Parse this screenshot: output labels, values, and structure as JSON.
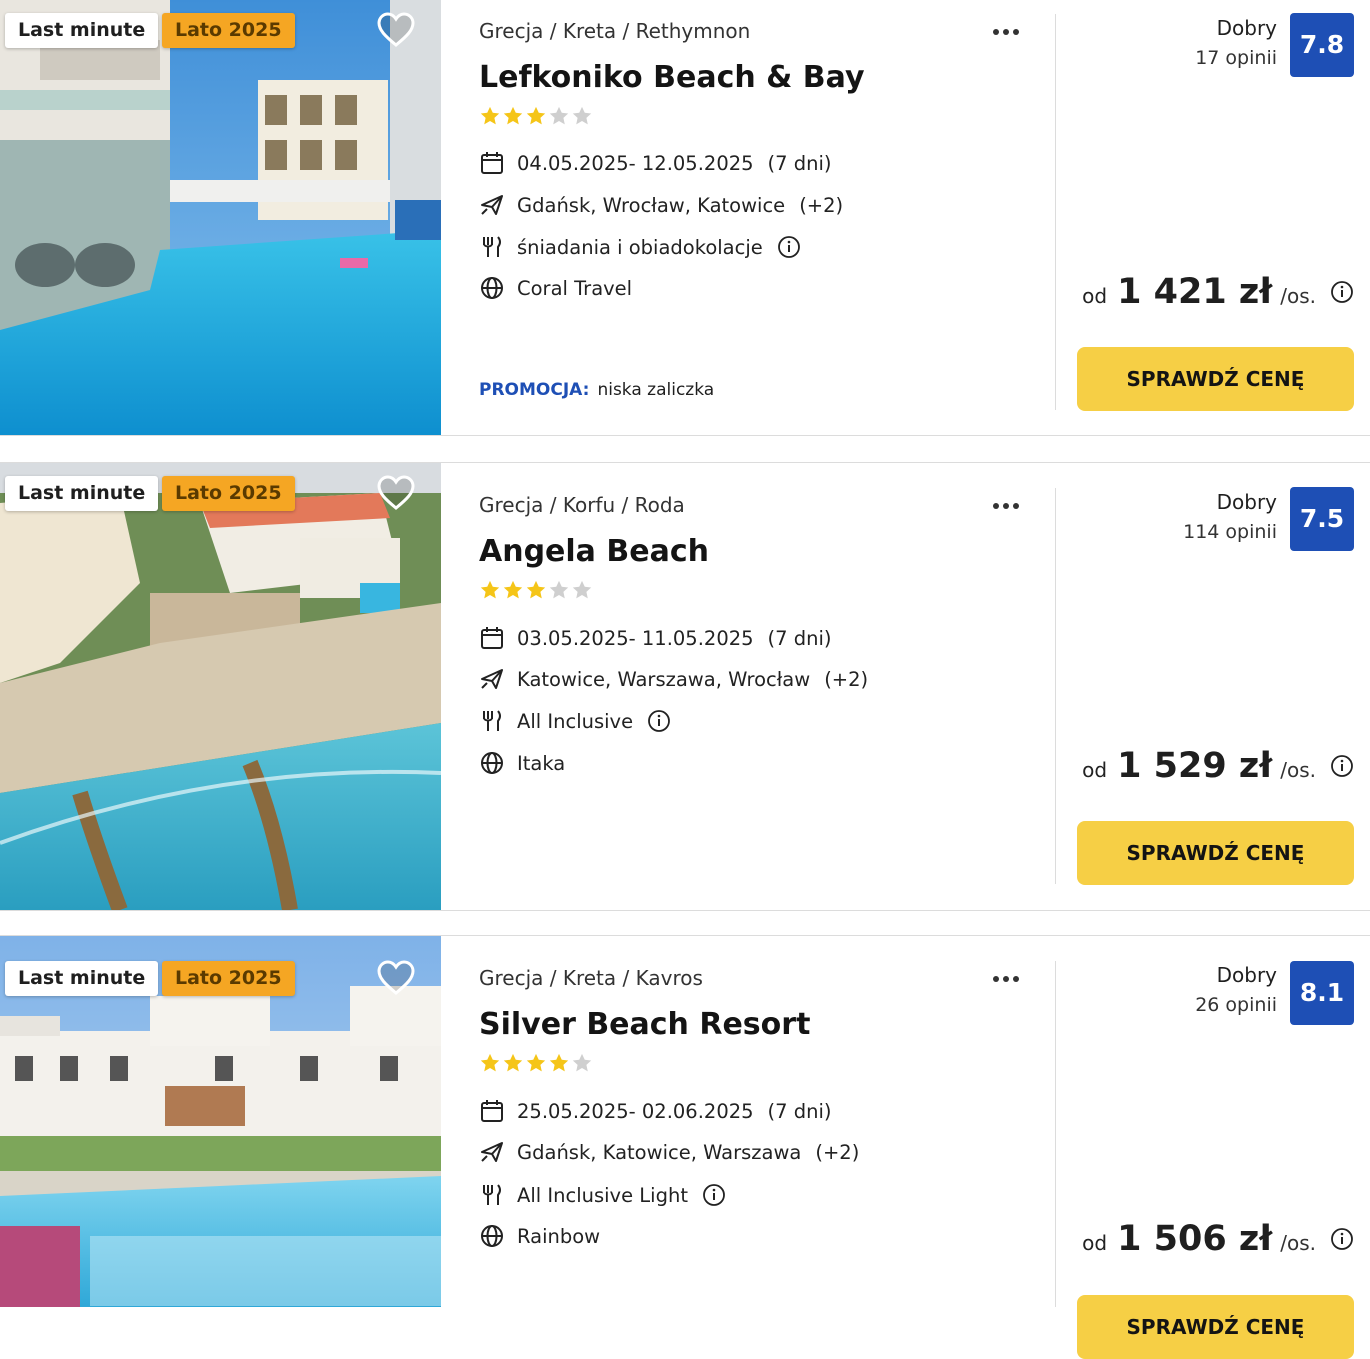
{
  "offers": [
    {
      "badge_last_minute": "Last minute",
      "badge_season": "Lato 2025",
      "breadcrumb": "Grecja / Kreta / Rethymnon",
      "name": "Lefkoniko Beach & Bay",
      "stars": 3,
      "dates": "04.05.2025- 12.05.2025",
      "duration": "(7 dni)",
      "departures": "Gdańsk, Wrocław, Katowice",
      "departures_more": "(+2)",
      "board": "śniadania i obiadokolacje",
      "operator": "Coral Travel",
      "promo_label": "PROMOCJA:",
      "promo_text": "niska zaliczka",
      "rating_word": "Dobry",
      "reviews": "17 opinii",
      "score": "7.8",
      "price_prefix": "od",
      "price": "1 421 zł",
      "price_suffix": "/os.",
      "cta": "SPRAWDŹ CENĘ",
      "image": "hotel-pool-photo"
    },
    {
      "badge_last_minute": "Last minute",
      "badge_season": "Lato 2025",
      "breadcrumb": "Grecja / Korfu / Roda",
      "name": "Angela Beach",
      "stars": 3,
      "dates": "03.05.2025- 11.05.2025",
      "duration": "(7 dni)",
      "departures": "Katowice, Warszawa, Wrocław",
      "departures_more": "(+2)",
      "board": "All Inclusive",
      "operator": "Itaka",
      "rating_word": "Dobry",
      "reviews": "114 opinii",
      "score": "7.5",
      "price_prefix": "od",
      "price": "1 529 zł",
      "price_suffix": "/os.",
      "cta": "SPRAWDŹ CENĘ",
      "image": "aerial-beach-photo"
    },
    {
      "badge_last_minute": "Last minute",
      "badge_season": "Lato 2025",
      "breadcrumb": "Grecja / Kreta / Kavros",
      "name": "Silver Beach Resort",
      "stars": 4,
      "dates": "25.05.2025- 02.06.2025",
      "duration": "(7 dni)",
      "departures": "Gdańsk, Katowice, Warszawa",
      "departures_more": "(+2)",
      "board": "All Inclusive Light",
      "operator": "Rainbow",
      "rating_word": "Dobry",
      "reviews": "26 opinii",
      "score": "8.1",
      "price_prefix": "od",
      "price": "1 506 zł",
      "price_suffix": "/os.",
      "cta": "SPRAWDŹ CENĘ",
      "image": "resort-pool-photo"
    }
  ],
  "icons": {
    "calendar": "calendar-icon",
    "departure": "plane-icon",
    "board": "cutlery-icon",
    "operator": "globe-icon",
    "info": "info-icon",
    "favorite": "heart-icon",
    "more": "more-dots-icon"
  },
  "colors": {
    "accent_blue": "#1e4fb5",
    "cta_yellow": "#f6cf45",
    "season_badge": "#f5a623",
    "star_filled": "#f5c518",
    "star_empty": "#cfcfcf"
  }
}
